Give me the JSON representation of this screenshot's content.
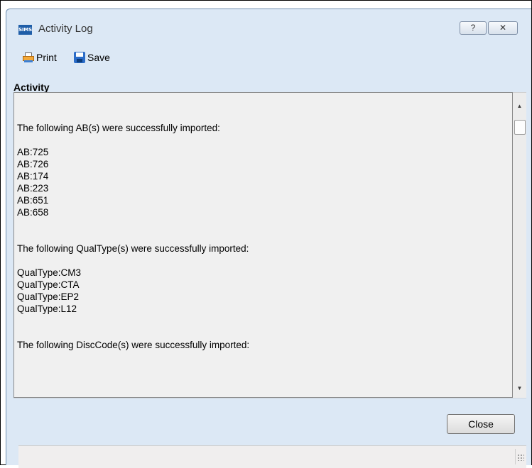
{
  "window": {
    "app_logo": "SIMS",
    "title": "Activity Log",
    "help_glyph": "?",
    "close_glyph": "✕"
  },
  "toolbar": {
    "print_label": "Print",
    "save_label": "Save"
  },
  "activity": {
    "section_label": "Activity",
    "log_lines": [
      "The following AB(s) were successfully imported:",
      "",
      "AB:725",
      "AB:726",
      "AB:174",
      "AB:223",
      "AB:651",
      "AB:658",
      "",
      "",
      "The following QualType(s) were successfully imported:",
      "",
      "QualType:CM3",
      "QualType:CTA",
      "QualType:EP2",
      "QualType:L12",
      "",
      "",
      "The following DiscCode(s) were successfully imported:"
    ]
  },
  "footer": {
    "close_label": "Close"
  },
  "icons": {
    "print": "printer-icon",
    "save": "floppy-disk-icon",
    "help": "question-mark-icon",
    "close": "close-icon",
    "scroll_up": "triangle-up-icon",
    "scroll_down": "triangle-down-icon",
    "grip": "resize-grip-icon"
  },
  "colors": {
    "window_bg": "#dce8f5",
    "panel_bg": "#f0f0f0",
    "logo_bg": "#1f5ea8"
  }
}
